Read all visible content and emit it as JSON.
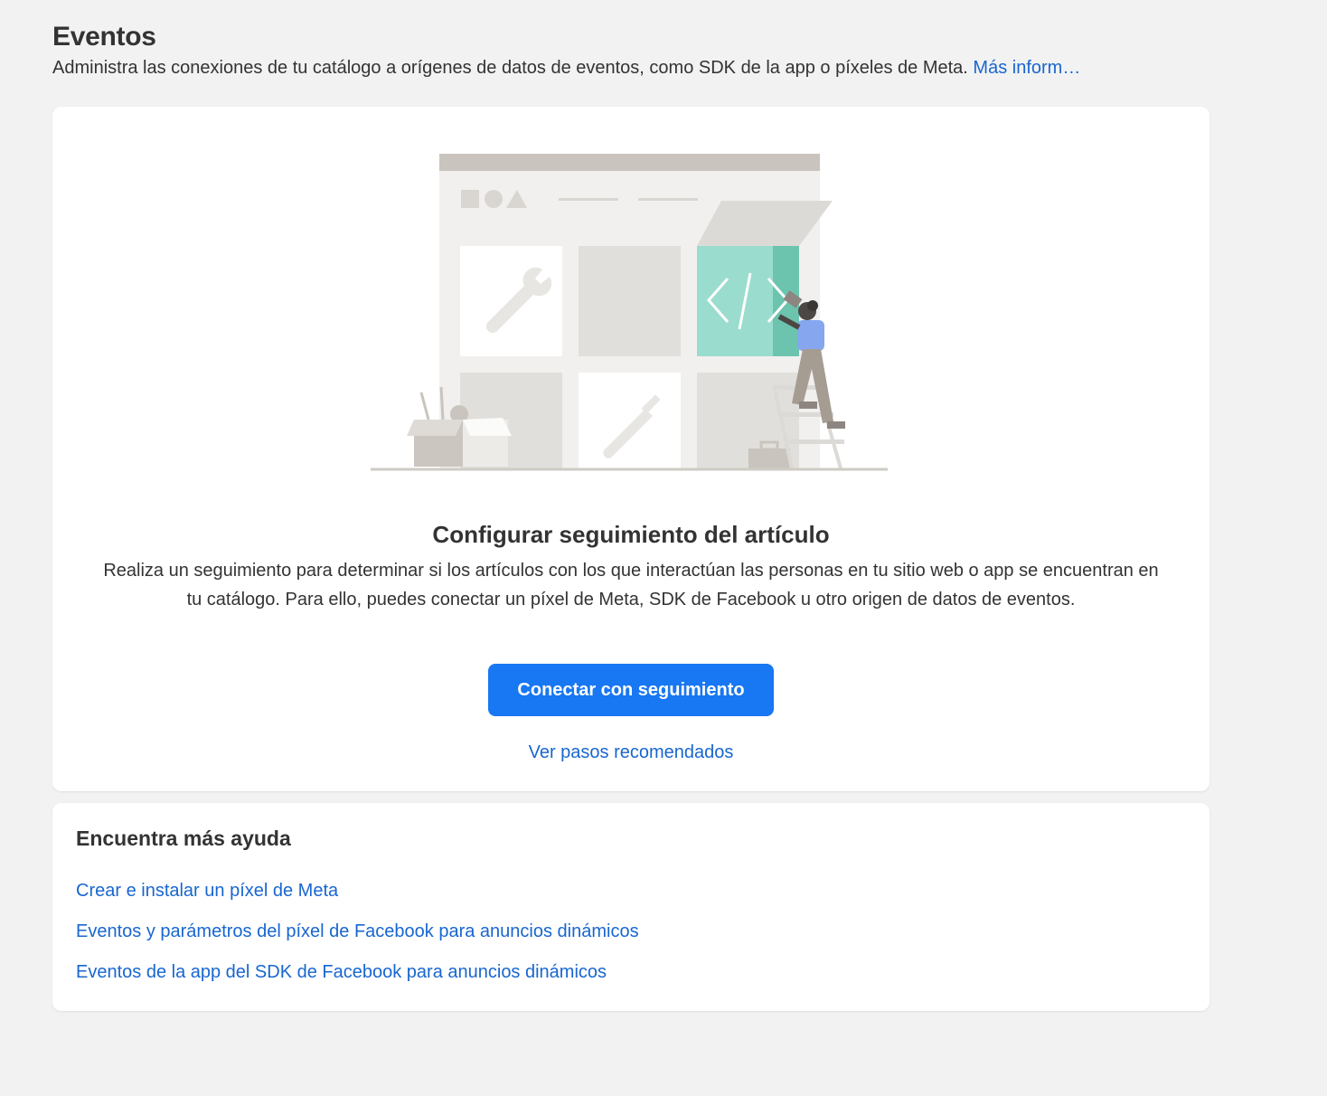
{
  "header": {
    "title": "Eventos",
    "subtitle": "Administra las conexiones de tu catálogo a orígenes de datos de eventos, como SDK de la app o píxeles de Meta.",
    "more_link": "Más inform…"
  },
  "setup": {
    "title": "Configurar seguimiento del artículo",
    "description": "Realiza un seguimiento para determinar si los artículos con los que interactúan las personas en tu sitio web o app se encuentran en tu catálogo. Para ello, puedes conectar un píxel de Meta, SDK de Facebook u otro origen de datos de eventos.",
    "connect_button": "Conectar con seguimiento",
    "steps_link": "Ver pasos recomendados"
  },
  "help": {
    "title": "Encuentra más ayuda",
    "links": [
      "Crear e instalar un píxel de Meta",
      "Eventos y parámetros del píxel de Facebook para anuncios dinámicos",
      "Eventos de la app del SDK de Facebook para anuncios dinámicos"
    ]
  },
  "colors": {
    "page_bg": "#f2f2f2",
    "primary_button": "#1877f2",
    "link": "#1866d0",
    "illustration_accent": "#9adccd"
  }
}
